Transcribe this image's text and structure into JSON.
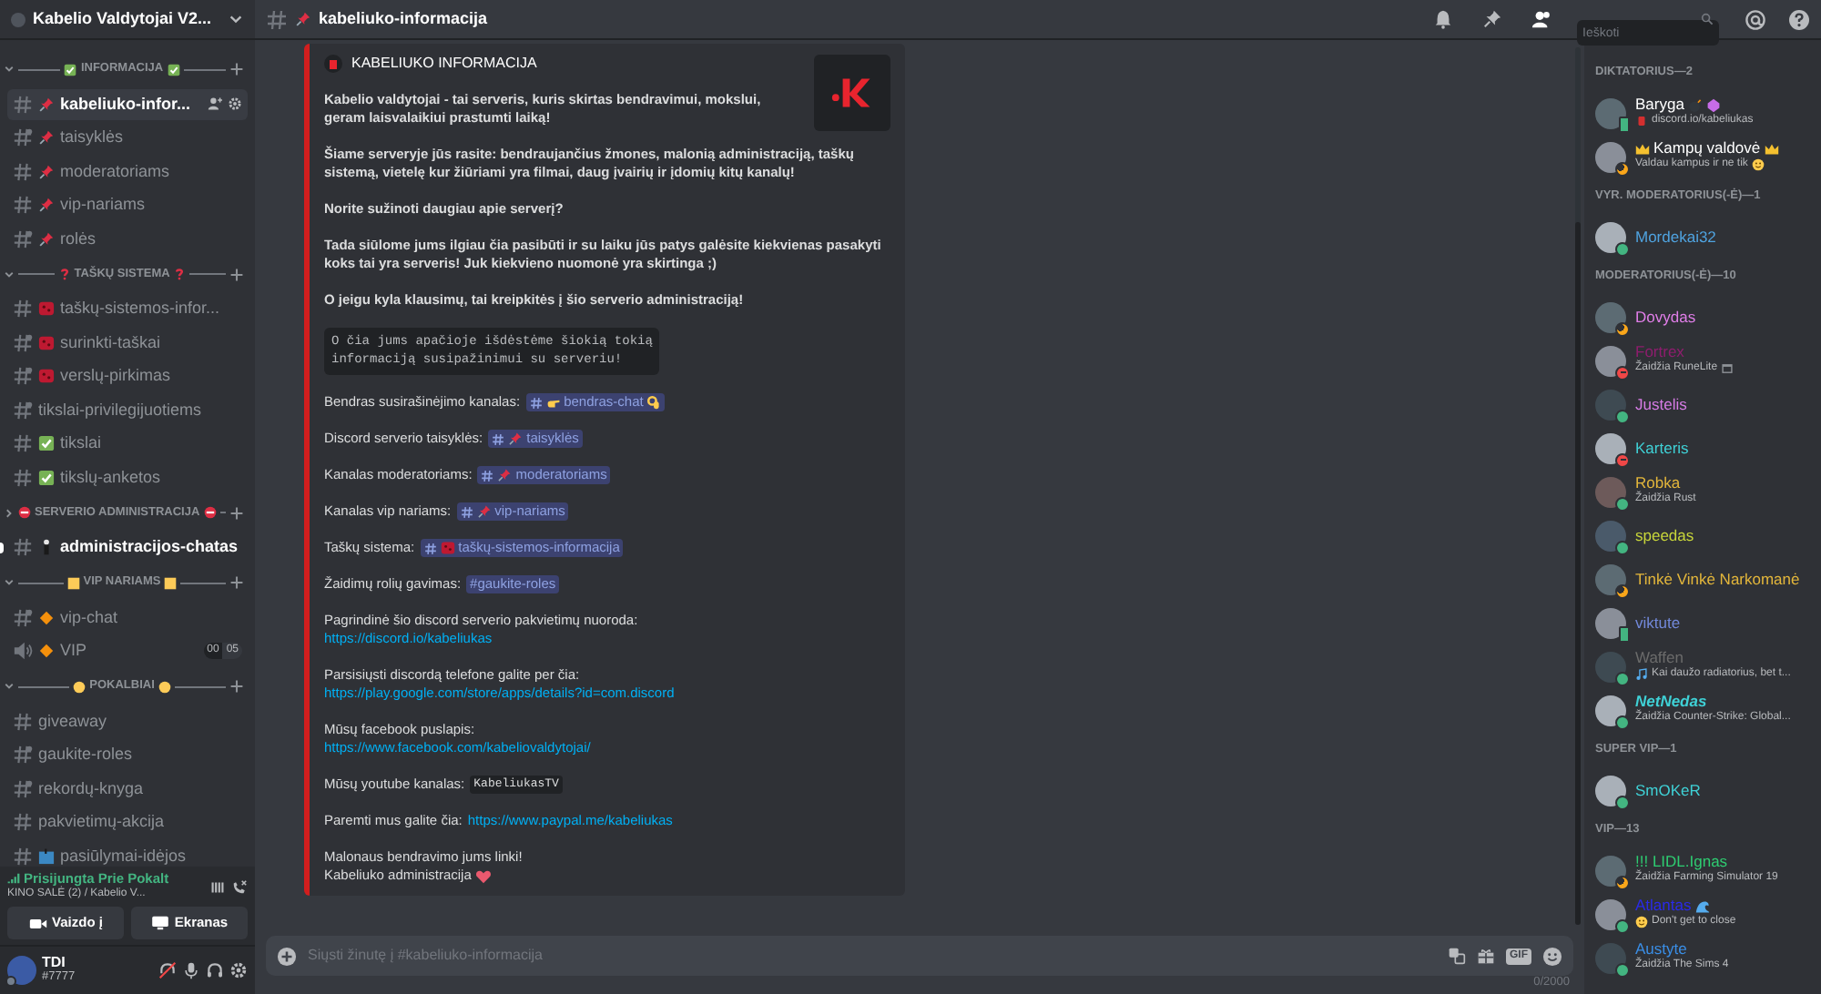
{
  "server": {
    "name": "Kabelio Valdytojai V2..."
  },
  "categories": [
    {
      "name": "INFORMACIJA",
      "expanded": true,
      "channels": [
        {
          "name": "kabeliuko-infor...",
          "kind": "text",
          "selected": true,
          "unread": false
        },
        {
          "name": "taisyklės",
          "kind": "restricted",
          "selected": false,
          "unread": false
        },
        {
          "name": "moderatoriams",
          "kind": "text",
          "selected": false,
          "unread": false
        },
        {
          "name": "vip-nariams",
          "kind": "text",
          "selected": false,
          "unread": false
        },
        {
          "name": "rolės",
          "kind": "restricted",
          "selected": false,
          "unread": false
        }
      ]
    },
    {
      "name": "TAŠKŲ SISTEMA",
      "expanded": true,
      "channels": [
        {
          "name": "taškų-sistemos-infor...",
          "kind": "text",
          "selected": false,
          "unread": false
        },
        {
          "name": "surinkti-taškai",
          "kind": "restricted",
          "selected": false,
          "unread": false
        },
        {
          "name": "verslų-pirkimas",
          "kind": "restricted",
          "selected": false,
          "unread": false
        },
        {
          "name": "tikslai-privilegijuotiems",
          "kind": "restricted",
          "selected": false,
          "unread": false
        },
        {
          "name": "tikslai",
          "kind": "text",
          "selected": false,
          "unread": false
        },
        {
          "name": "tikslų-anketos",
          "kind": "text",
          "selected": false,
          "unread": false
        }
      ]
    },
    {
      "name": "SERVERIO ADMINISTRACIJA",
      "expanded": false,
      "channels": [
        {
          "name": "administracijos-chatas",
          "kind": "text",
          "selected": false,
          "unread": true
        }
      ]
    },
    {
      "name": "VIP NARIAMS",
      "expanded": true,
      "channels": [
        {
          "name": "vip-chat",
          "kind": "restricted",
          "selected": false,
          "unread": false
        },
        {
          "name": "VIP",
          "kind": "voice",
          "selected": false,
          "unread": false,
          "user_count": "00",
          "user_limit": "05"
        }
      ]
    },
    {
      "name": "POKALBIAI",
      "expanded": true,
      "channels": [
        {
          "name": "giveaway",
          "kind": "text",
          "selected": false,
          "unread": false
        },
        {
          "name": "gaukite-roles",
          "kind": "restricted",
          "selected": false,
          "unread": false
        },
        {
          "name": "rekordų-knyga",
          "kind": "restricted",
          "selected": false,
          "unread": false
        },
        {
          "name": "pakvietimų-akcija",
          "kind": "text",
          "selected": false,
          "unread": false
        },
        {
          "name": "pasiūlymai-idėjos",
          "kind": "text",
          "selected": false,
          "unread": false
        }
      ]
    }
  ],
  "voice_panel": {
    "status": "Prisijungta Prie Pokalt",
    "channel": "KINO SALĖ (2) / Kabelio V...",
    "buttons": [
      {
        "label": "Vaizdo į",
        "kind": "camera"
      },
      {
        "label": "Ekranas",
        "kind": "screen"
      }
    ]
  },
  "user_panel": {
    "name": "TDI",
    "tag": "#7777"
  },
  "chat_header": {
    "channel": "kabeliuko-informacija",
    "search_placeholder": "Ieškoti"
  },
  "embed": {
    "author": "KABELIUKO INFORMACIJA",
    "paragraphs": [
      "Kabelio valdytojai - tai serveris, kuris skirtas bendravimui, mokslui, geram laisvalaikiui prastumti laiką!",
      "Šiame serveryje jūs rasite: bendraujančius žmones, malonią administraciją, taškų sistemą, vietelę kur žiūriami yra filmai, daug įvairių ir įdomių kitų kanalų!",
      "Norite sužinoti daugiau apie serverį?",
      "Tada siūlome jums ilgiau čia pasibūti ir su laiku jūs patys galėsite kiekvienas pasakyti koks tai yra serveris! Juk kiekvieno nuomonė yra skirtinga ;)",
      "O jeigu kyla klausimų, tai kreipkitės į šio serverio administraciją!"
    ],
    "code": [
      "O čia jums apačioje išdėstėme šiokią tokią",
      "informaciją susipažinimui su serveriu!"
    ],
    "lines": [
      {
        "kind": "mention",
        "label": "Bendras susirašinėjimo kanalas:",
        "mention": "bendras-chat"
      },
      {
        "kind": "mention",
        "label": "Discord serverio taisyklės:",
        "mention": "taisyklės"
      },
      {
        "kind": "mention",
        "label": "Kanalas moderatoriams:",
        "mention": "moderatoriams"
      },
      {
        "kind": "mention",
        "label": "Kanalas vip nariams:",
        "mention": "vip-nariams"
      },
      {
        "kind": "mention",
        "label": "Taškų sistema:",
        "mention": "taškų-sistemos-informacija"
      },
      {
        "kind": "plain_mention",
        "label": "Žaidimų rolių gavimas:",
        "mention": "#gaukite-roles"
      },
      {
        "kind": "link",
        "label": "Pagrindinė šio discord serverio pakvietimų nuoroda:",
        "url": "https://discord.io/kabeliukas"
      },
      {
        "kind": "link",
        "label": "Parsisiųsti discordą telefone galite per čia:",
        "url": "https://play.google.com/store/apps/details?id=com.discord"
      },
      {
        "kind": "link",
        "label": "Mūsų facebook puslapis:",
        "url": "https://www.facebook.com/kabeliovaldytojai/"
      },
      {
        "kind": "code",
        "label": "Mūsų youtube kanalas:",
        "code": "KabeliukasTV"
      },
      {
        "kind": "inline_link",
        "label": "Paremti mus galite čia:",
        "url": "https://www.paypal.me/kabeliukas"
      },
      {
        "kind": "closing",
        "label": "Malonaus bendravimo jums linki!",
        "signature": "Kabeliuko administracija"
      }
    ]
  },
  "composer": {
    "placeholder": "Siųsti žinutę į #kabeliuko-informacija",
    "gif": "GIF",
    "counter": "0/2000"
  },
  "member_groups": [
    {
      "title": "DIKTATORIUS—2",
      "members": [
        {
          "name": "Baryga",
          "color": "#ffffff",
          "kind": "mobile",
          "activity": "discord.io/kabeliukas"
        },
        {
          "name": "Kampų valdovė",
          "color": "#ffffff",
          "kind": "idle",
          "activity": "Valdau kampus ir ne tik"
        }
      ]
    },
    {
      "title": "VYR. MODERATORIUS(-Ė)—1",
      "members": [
        {
          "name": "Mordekai32",
          "color": "#4fa3e0",
          "kind": "online"
        }
      ]
    },
    {
      "title": "MODERATORIUS(-Ė)—10",
      "members": [
        {
          "name": "Dovydas",
          "color": "#e07ee8",
          "kind": "idle"
        },
        {
          "name": "Fortrex",
          "color": "#8e1d6e",
          "kind": "dnd",
          "activity": "Žaidžia RuneLite"
        },
        {
          "name": "Justelis",
          "color": "#d77ce6",
          "kind": "online"
        },
        {
          "name": "Karteris",
          "color": "#3fd1d6",
          "kind": "dnd"
        },
        {
          "name": "Robka",
          "color": "#e3b63b",
          "kind": "online",
          "activity": "Žaidžia Rust"
        },
        {
          "name": "speedas",
          "color": "#c8d63a",
          "kind": "online"
        },
        {
          "name": "Tinkė Vinkė Narkomanė",
          "color": "#e3b63b",
          "kind": "idle"
        },
        {
          "name": "viktute",
          "color": "#7289da",
          "kind": "mobile"
        },
        {
          "name": "Waffen",
          "color": "#6b6b6b",
          "kind": "online",
          "activity": "Kai daužo radiatorius, bet t..."
        },
        {
          "name": "NetNedas",
          "color": "#3fd1d6",
          "kind": "online",
          "italic": true,
          "activity": "Žaidžia Counter-Strike: Global..."
        }
      ]
    },
    {
      "title": "SUPER VIP—1",
      "members": [
        {
          "name": "SmOKeR",
          "color": "#3fd1d6",
          "kind": "online"
        }
      ]
    },
    {
      "title": "VIP—13",
      "members": [
        {
          "name": "!!! LIDL.Ignas",
          "color": "#2ecc71",
          "kind": "idle",
          "activity": "Žaidžia Farming Simulator 19"
        },
        {
          "name": "Atlantas",
          "color": "#2a2ae8",
          "kind": "online",
          "activity": "Don't get to close"
        },
        {
          "name": "Austyte",
          "color": "#3a8ee6",
          "kind": "online",
          "activity": "Žaidžia The Sims 4"
        }
      ]
    }
  ]
}
